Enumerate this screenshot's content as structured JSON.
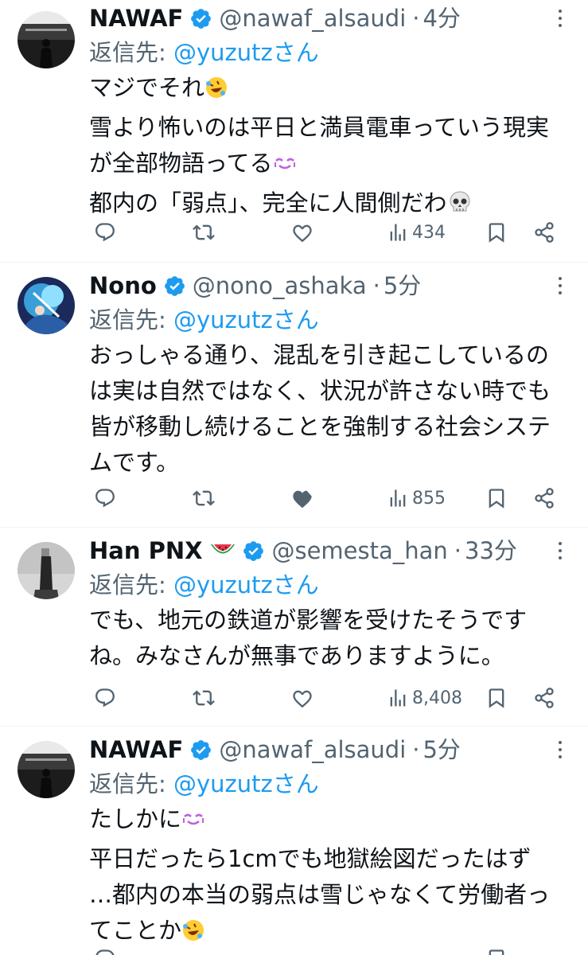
{
  "reply_prefix": "返信先: ",
  "posts": [
    {
      "name": "NAWAF",
      "handle": "@nawaf_alsaudi",
      "time": "4分",
      "reply_to": "@yuzutzさん",
      "lines": [
        "マジでそれ",
        "雪より怖いのは平日と満員電車っていう現実",
        "が全部物語ってる",
        "都内の「弱点」、完全に人間側だわ"
      ],
      "views": "434"
    },
    {
      "name": "Nono",
      "handle": "@nono_ashaka",
      "time": "5分",
      "reply_to": "@yuzutzさん",
      "lines": [
        "おっしゃる通り、混乱を引き起こしているの",
        "は実は自然ではなく、状況が許さない時でも",
        "皆が移動し続けることを強制する社会システ",
        "ムです。"
      ],
      "views": "855"
    },
    {
      "name": "Han PNX",
      "handle": "@semesta_han",
      "time": "33分",
      "reply_to": "@yuzutzさん",
      "lines": [
        "でも、地元の鉄道が影響を受けたそうです",
        "ね。みなさんが無事でありますように。"
      ],
      "views": "8,408"
    },
    {
      "name": "NAWAF",
      "handle": "@nawaf_alsaudi",
      "time": "5分",
      "reply_to": "@yuzutzさん",
      "lines": [
        "たしかに",
        "平日だったら1cmでも地獄絵図だったはず",
        "…都内の本当の弱点は雪じゃなくて労働者っ",
        "てことか"
      ]
    }
  ],
  "colors": {
    "accent": "#1d9bf0",
    "muted": "#536471",
    "text": "#0f1419",
    "divider": "#eff3f4"
  }
}
